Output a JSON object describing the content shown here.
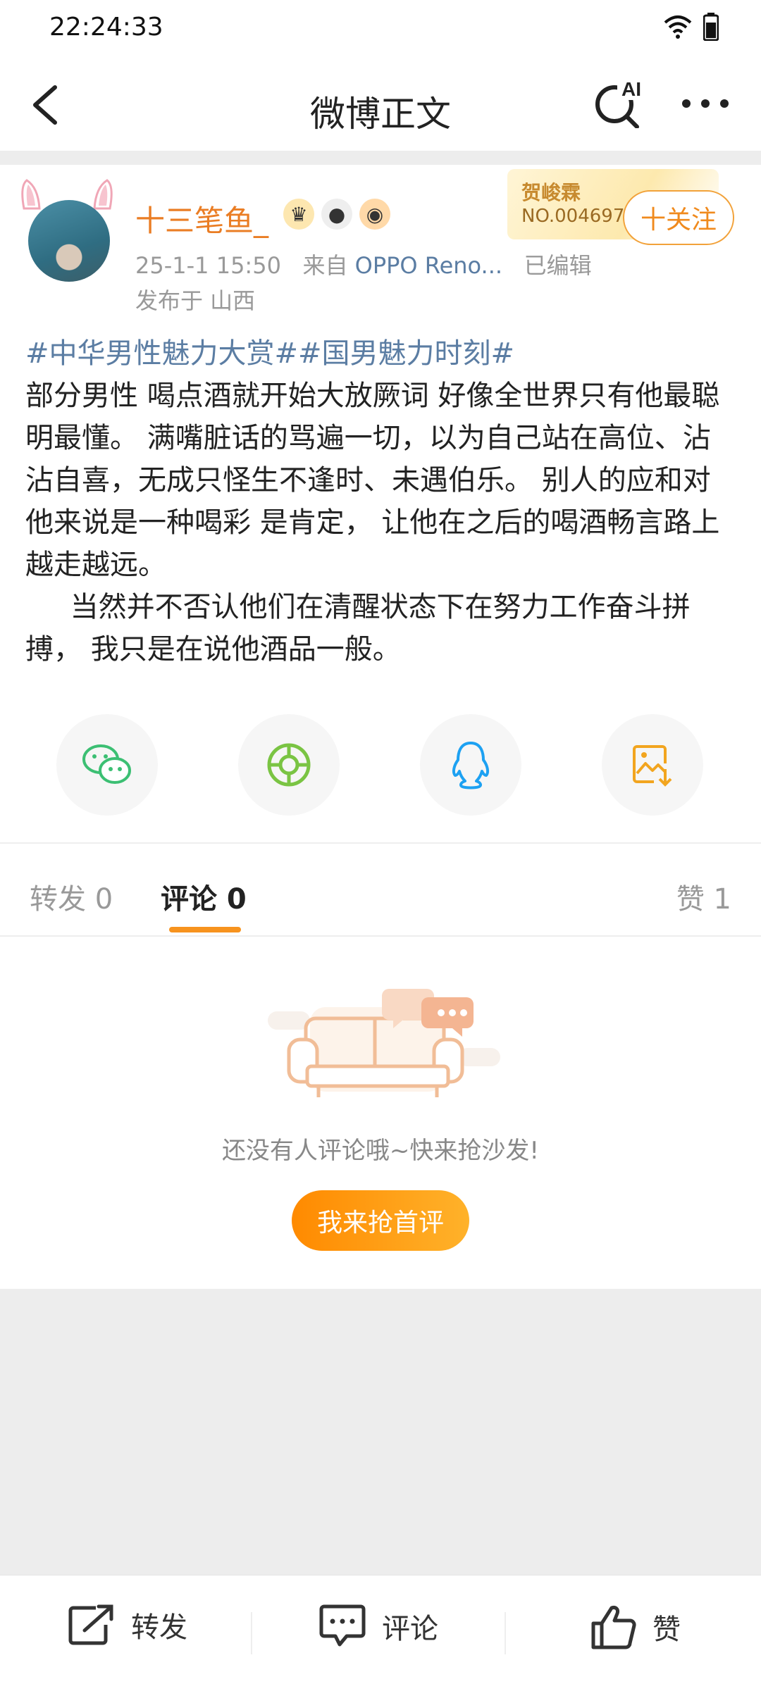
{
  "status": {
    "time": "22:24:33"
  },
  "nav": {
    "title": "微博正文",
    "ai_label": "AI"
  },
  "post": {
    "username": "十三笔鱼_",
    "fan_card": {
      "name": "贺峻霖",
      "number": "NO.004697"
    },
    "follow_label": "十关注",
    "date": "25-1-1 15:50",
    "from_label": "来自",
    "source": "OPPO Reno...",
    "edited": "已编辑",
    "location": "发布于 山西",
    "hashtags": "#中华男性魅力大赏##国男魅力时刻#",
    "body": "部分男性 喝点酒就开始大放厥词 好像全世界只有他最聪明最懂。 满嘴脏话的骂遍一切，以为自己站在高位、沾沾自喜，无成只怪生不逢时、未遇伯乐。 别人的应和对他来说是一种喝彩 是肯定， 让他在之后的喝酒畅言路上越走越远。\n     当然并不否认他们在清醒状态下在努力工作奋斗拼搏， 我只是在说他酒品一般。"
  },
  "tabs": {
    "repost": "转发 0",
    "comment": "评论 0",
    "like": "赞 1"
  },
  "empty": {
    "message": "还没有人评论哦~快来抢沙发!",
    "button": "我来抢首评"
  },
  "bottom": {
    "repost": "转发",
    "comment": "评论",
    "like": "赞"
  }
}
